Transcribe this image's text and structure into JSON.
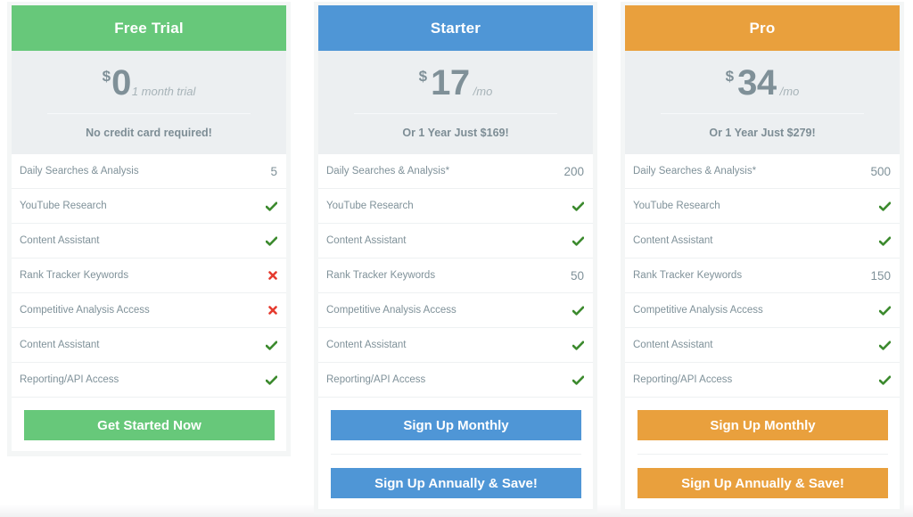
{
  "colors": {
    "free": "#67C87A",
    "starter": "#4F96D6",
    "pro": "#E9A03D",
    "check": "#3C8A2E",
    "cross": "#E53B2F"
  },
  "plans": [
    {
      "name": "Free Trial",
      "currency": "$",
      "amount": "0",
      "period": "1 month trial",
      "note": "No credit card required!",
      "features": [
        {
          "label": "Daily Searches & Analysis",
          "value": "5",
          "status": "text"
        },
        {
          "label": "YouTube Research",
          "value": "",
          "status": "check-icon"
        },
        {
          "label": "Content Assistant",
          "value": "",
          "status": "check-icon"
        },
        {
          "label": "Rank Tracker Keywords",
          "value": "",
          "status": "cross-icon"
        },
        {
          "label": "Competitive Analysis Access",
          "value": "",
          "status": "cross-icon"
        },
        {
          "label": "Content Assistant",
          "value": "",
          "status": "check-icon"
        },
        {
          "label": "Reporting/API Access",
          "value": "",
          "status": "check-icon"
        }
      ],
      "buttons": [
        "Get Started Now"
      ]
    },
    {
      "name": "Starter",
      "currency": "$",
      "amount": "17",
      "period": "/mo",
      "note": "Or 1 Year Just $169!",
      "features": [
        {
          "label": "Daily Searches & Analysis*",
          "value": "200",
          "status": "text"
        },
        {
          "label": "YouTube Research",
          "value": "",
          "status": "check-icon"
        },
        {
          "label": "Content Assistant",
          "value": "",
          "status": "check-icon"
        },
        {
          "label": "Rank Tracker Keywords",
          "value": "50",
          "status": "text"
        },
        {
          "label": "Competitive Analysis Access",
          "value": "",
          "status": "check-icon"
        },
        {
          "label": "Content Assistant",
          "value": "",
          "status": "check-icon"
        },
        {
          "label": "Reporting/API Access",
          "value": "",
          "status": "check-icon"
        }
      ],
      "buttons": [
        "Sign Up Monthly",
        "Sign Up Annually & Save!"
      ]
    },
    {
      "name": "Pro",
      "currency": "$",
      "amount": "34",
      "period": "/mo",
      "note": "Or 1 Year Just $279!",
      "features": [
        {
          "label": "Daily Searches & Analysis*",
          "value": "500",
          "status": "text"
        },
        {
          "label": "YouTube Research",
          "value": "",
          "status": "check-icon"
        },
        {
          "label": "Content Assistant",
          "value": "",
          "status": "check-icon"
        },
        {
          "label": "Rank Tracker Keywords",
          "value": "150",
          "status": "text"
        },
        {
          "label": "Competitive Analysis Access",
          "value": "",
          "status": "check-icon"
        },
        {
          "label": "Content Assistant",
          "value": "",
          "status": "check-icon"
        },
        {
          "label": "Reporting/API Access",
          "value": "",
          "status": "check-icon"
        }
      ],
      "buttons": [
        "Sign Up Monthly",
        "Sign Up Annually & Save!"
      ]
    }
  ]
}
